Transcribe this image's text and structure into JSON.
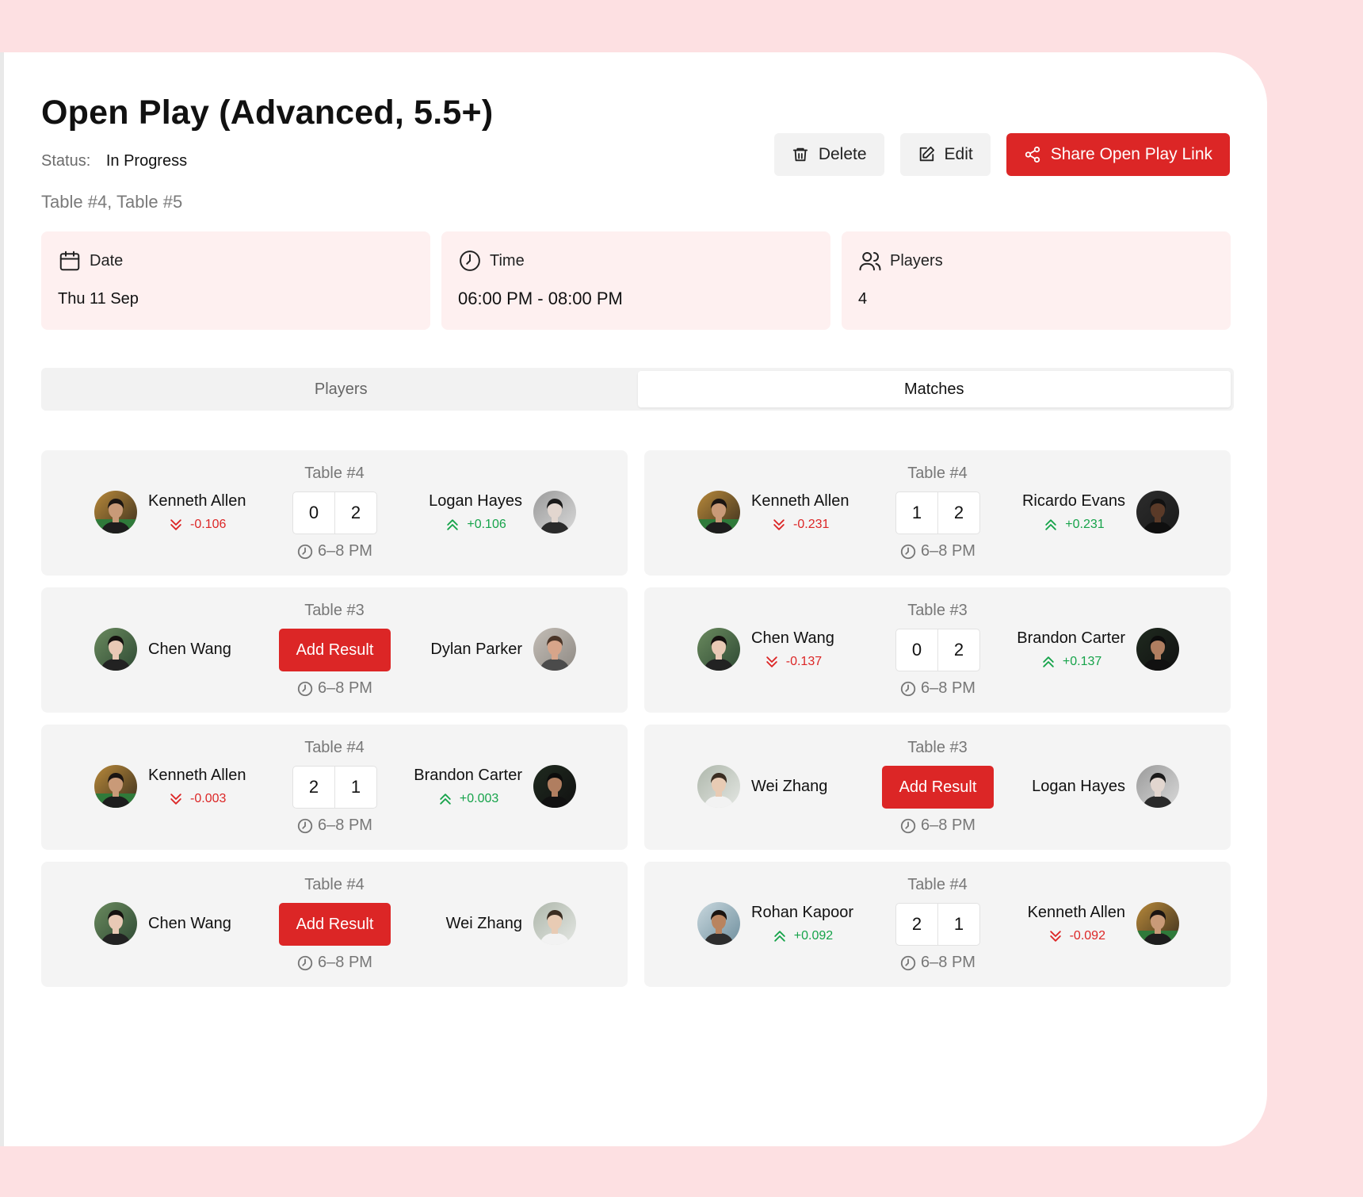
{
  "event": {
    "title": "Open Play (Advanced, 5.5+)",
    "status_label": "Status:",
    "status_value": "In Progress",
    "tables": "Table #4, Table #5"
  },
  "actions": {
    "delete_label": "Delete",
    "edit_label": "Edit",
    "share_label": "Share Open Play Link"
  },
  "info": {
    "date_label": "Date",
    "date_value": "Thu 11 Sep",
    "time_label": "Time",
    "time_value": "06:00 PM - 08:00 PM",
    "players_label": "Players",
    "players_value": "4"
  },
  "tabs": {
    "players": "Players",
    "matches": "Matches",
    "active": "matches"
  },
  "add_result_label": "Add Result",
  "colors": {
    "accent": "#dc2626",
    "up": "#16a34a",
    "down": "#dc2626"
  },
  "matches": [
    {
      "table": "Table #4",
      "time": "6–8 PM",
      "p1": {
        "name": "Kenneth Allen",
        "delta": "-0.106",
        "dir": "down",
        "avatar": "kenneth-avatar"
      },
      "p2": {
        "name": "Logan Hayes",
        "delta": "+0.106",
        "dir": "up",
        "avatar": "logan-avatar"
      },
      "score": [
        "0",
        "2"
      ]
    },
    {
      "table": "Table #4",
      "time": "6–8 PM",
      "p1": {
        "name": "Kenneth Allen",
        "delta": "-0.231",
        "dir": "down",
        "avatar": "kenneth-avatar"
      },
      "p2": {
        "name": "Ricardo Evans",
        "delta": "+0.231",
        "dir": "up",
        "avatar": "ricardo-avatar"
      },
      "score": [
        "1",
        "2"
      ]
    },
    {
      "table": "Table #3",
      "time": "6–8 PM",
      "p1": {
        "name": "Chen Wang",
        "avatar": "chen-avatar"
      },
      "p2": {
        "name": "Dylan Parker",
        "avatar": "dylan-avatar"
      },
      "score": null
    },
    {
      "table": "Table #3",
      "time": "6–8 PM",
      "p1": {
        "name": "Chen Wang",
        "delta": "-0.137",
        "dir": "down",
        "avatar": "chen-avatar"
      },
      "p2": {
        "name": "Brandon Carter",
        "delta": "+0.137",
        "dir": "up",
        "avatar": "brandon-avatar"
      },
      "score": [
        "0",
        "2"
      ]
    },
    {
      "table": "Table #4",
      "time": "6–8 PM",
      "p1": {
        "name": "Kenneth Allen",
        "delta": "-0.003",
        "dir": "down",
        "avatar": "kenneth-avatar"
      },
      "p2": {
        "name": "Brandon Carter",
        "delta": "+0.003",
        "dir": "up",
        "avatar": "brandon-avatar"
      },
      "score": [
        "2",
        "1"
      ]
    },
    {
      "table": "Table #3",
      "time": "6–8 PM",
      "p1": {
        "name": "Wei Zhang",
        "avatar": "wei-avatar"
      },
      "p2": {
        "name": "Logan Hayes",
        "avatar": "logan-avatar"
      },
      "score": null
    },
    {
      "table": "Table #4",
      "time": "6–8 PM",
      "p1": {
        "name": "Chen Wang",
        "avatar": "chen-avatar"
      },
      "p2": {
        "name": "Wei Zhang",
        "avatar": "wei-avatar"
      },
      "score": null
    },
    {
      "table": "Table #4",
      "time": "6–8 PM",
      "p1": {
        "name": "Rohan Kapoor",
        "delta": "+0.092",
        "dir": "up",
        "avatar": "rohan-avatar"
      },
      "p2": {
        "name": "Kenneth Allen",
        "delta": "-0.092",
        "dir": "down",
        "avatar": "kenneth-avatar"
      },
      "score": [
        "2",
        "1"
      ]
    }
  ]
}
